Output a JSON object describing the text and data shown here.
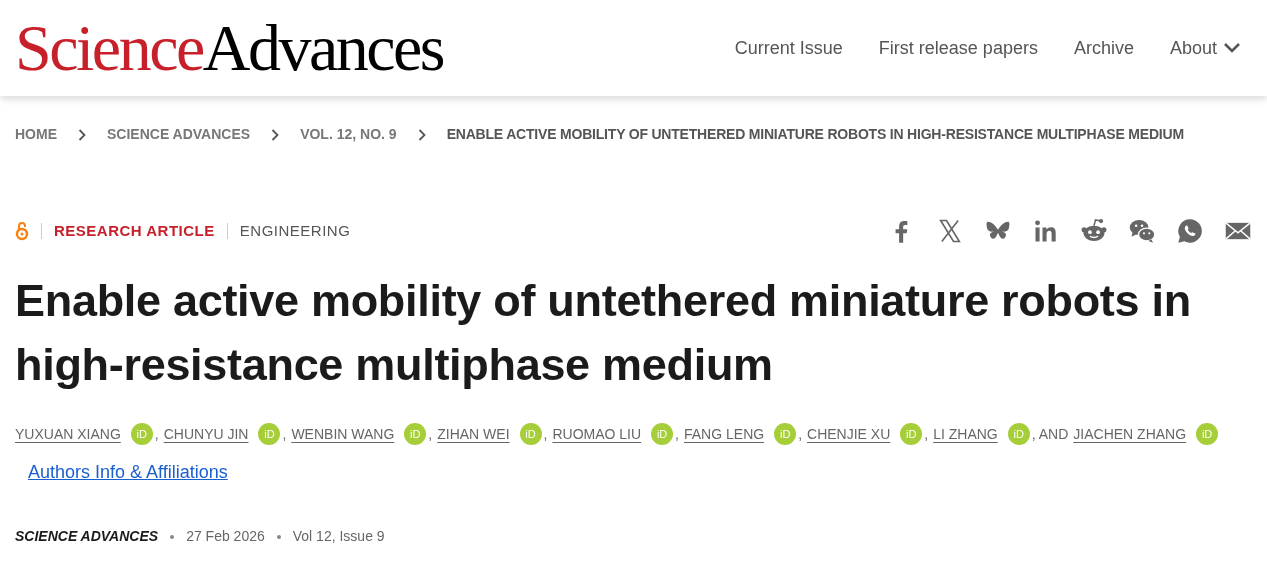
{
  "logo": {
    "part_1": "Science",
    "part_2": "Advances"
  },
  "nav": [
    {
      "label": "Current Issue",
      "kind": "link"
    },
    {
      "label": "First release papers",
      "kind": "link"
    },
    {
      "label": "Archive",
      "kind": "link"
    },
    {
      "label": "About",
      "kind": "dropdown"
    }
  ],
  "breadcrumb": [
    {
      "label": "HOME",
      "current": false
    },
    {
      "label": "SCIENCE ADVANCES",
      "current": false
    },
    {
      "label": "VOL. 12, NO. 9",
      "current": false
    },
    {
      "label": "ENABLE ACTIVE MOBILITY OF UNTETHERED MINIATURE ROBOTS IN HIGH-RESISTANCE MULTIPHASE MEDIUM",
      "current": true
    }
  ],
  "article": {
    "open_access": true,
    "type": "RESEARCH ARTICLE",
    "subject": "ENGINEERING",
    "share": [
      {
        "kind": "facebook"
      },
      {
        "kind": "x"
      },
      {
        "kind": "bluesky"
      },
      {
        "kind": "linkedin"
      },
      {
        "kind": "reddit"
      },
      {
        "kind": "wechat"
      },
      {
        "kind": "whatsapp"
      },
      {
        "kind": "email"
      }
    ],
    "title": "Enable active mobility of untethered miniature robots in high-resistance multiphase medium",
    "authors": [
      {
        "name": "YUXUAN XIANG",
        "badge": "iD"
      },
      {
        "prefix": ",",
        "name": "CHUNYU JIN",
        "badge": "iD"
      },
      {
        "prefix": ",",
        "name": "WENBIN WANG",
        "badge": "iD"
      },
      {
        "prefix": ",",
        "name": "ZIHAN WEI",
        "badge": "iD"
      },
      {
        "prefix": ",",
        "name": "RUOMAO LIU",
        "badge": "iD"
      },
      {
        "prefix": ",",
        "name": "FANG LENG",
        "badge": "iD"
      },
      {
        "prefix": ",",
        "name": "CHENJIE XU",
        "badge": "iD"
      },
      {
        "prefix": ",",
        "name": "LI ZHANG",
        "badge": "iD"
      },
      {
        "prefix": ", AND",
        "name": "JIACHEN ZHANG",
        "badge": "iD"
      }
    ],
    "affiliations_link": "Authors Info & Affiliations",
    "journal": "SCIENCE ADVANCES",
    "date": "27 Feb 2026",
    "issue": "Vol 12, Issue 9"
  }
}
